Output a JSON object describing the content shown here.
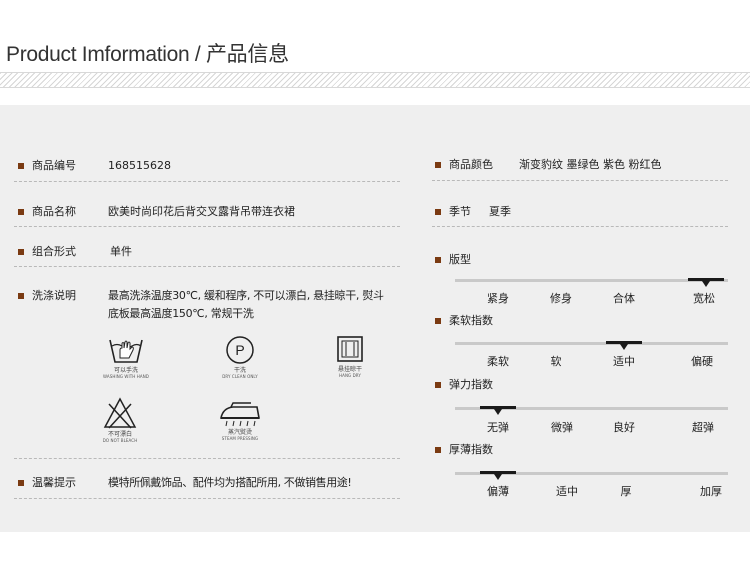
{
  "header": {
    "title": "Product Imformation / 产品信息"
  },
  "left": {
    "item_no": {
      "label": "商品编号",
      "value": "168515628"
    },
    "item_name": {
      "label": "商品名称",
      "value": "欧美时尚印花后背交叉露背吊带连衣裙"
    },
    "combo": {
      "label": "组合形式",
      "value": "单件"
    },
    "wash": {
      "label": "洗涤说明",
      "line1": "最高洗涤温度30℃, 缓和程序, 不可以漂白, 悬挂晾干, 熨斗",
      "line2": "底板最高温度150℃, 常规干洗"
    },
    "care_icons": [
      {
        "icon": "hand-wash-icon",
        "cn": "可以手洗",
        "en": "WASHING WITH HAND"
      },
      {
        "icon": "dry-clean-icon",
        "cn": "干洗",
        "en": "DRY CLEAN ONLY"
      },
      {
        "icon": "hang-dry-icon",
        "cn": "悬挂晾干",
        "en": "HANG DRY"
      },
      {
        "icon": "no-bleach-icon",
        "cn": "不可漂白",
        "en": "DO NOT BLEACH"
      },
      {
        "icon": "steam-iron-icon",
        "cn": "蒸汽熨烫",
        "en": "STEAM PRESSING"
      }
    ],
    "tip": {
      "label": "温馨提示",
      "value": "模特所佩戴饰品、配件均为搭配所用, 不做销售用途!"
    }
  },
  "right": {
    "color": {
      "label": "商品颜色",
      "value": "渐变豹纹 墨绿色 紫色 粉红色"
    },
    "season": {
      "label": "季节",
      "value": "夏季"
    },
    "scales": [
      {
        "title": "版型",
        "labels": [
          "紧身",
          "修身",
          "合体",
          "宽松"
        ],
        "selected_index": 3
      },
      {
        "title": "柔软指数",
        "labels": [
          "柔软",
          "软",
          "适中",
          "偏硬"
        ],
        "selected_index": 2
      },
      {
        "title": "弹力指数",
        "labels": [
          "无弹",
          "微弹",
          "良好",
          "超弹"
        ],
        "selected_index": 0
      },
      {
        "title": "厚薄指数",
        "labels": [
          "偏薄",
          "适中",
          "厚",
          "加厚"
        ],
        "selected_index": 0
      }
    ]
  },
  "colors": {
    "bullet": "#7a3a12",
    "warning": "#d42020",
    "panel_bg": "#efefef"
  }
}
